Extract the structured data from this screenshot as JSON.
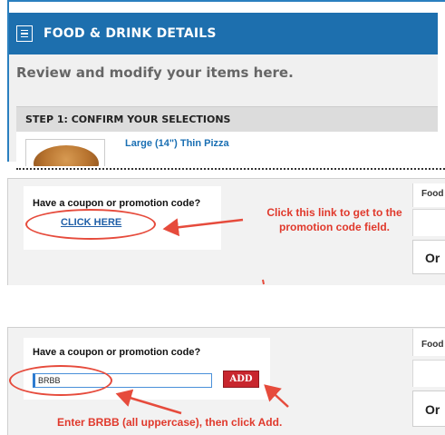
{
  "panel1": {
    "header_title": "FOOD & DRINK DETAILS",
    "header_icon": "document-icon",
    "subtitle": "Review and modify your items here.",
    "step_label": "STEP 1: CONFIRM YOUR SELECTIONS",
    "item_title": "Large (14\") Thin Pizza",
    "colors": {
      "header_bg": "#1d6fae",
      "link": "#1a6fb3"
    }
  },
  "panel2": {
    "coupon_question": "Have a coupon or promotion code?",
    "click_here_label": "CLICK HERE",
    "annotation": "Click this link to get to the promotion code field.",
    "side_food": "Food",
    "side_order": "Or"
  },
  "panel3": {
    "coupon_question": "Have a coupon or promotion code?",
    "code_input_value": "BRBB",
    "add_label": "ADD",
    "annotation": "Enter BRBB (all uppercase), then click Add.",
    "side_food": "Food",
    "side_order": "Or",
    "colors": {
      "add_button": "#c8262e",
      "annotation": "#e0392c"
    }
  }
}
